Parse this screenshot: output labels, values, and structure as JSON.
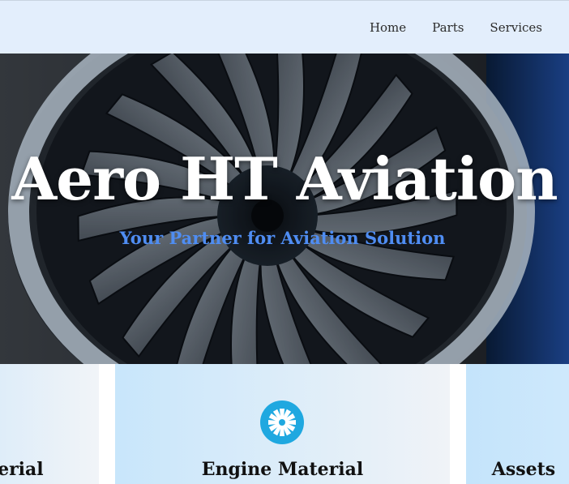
{
  "nav": {
    "items": [
      {
        "label": "Home"
      },
      {
        "label": "Parts"
      },
      {
        "label": "Services"
      }
    ]
  },
  "hero": {
    "title": "Aero HT Aviation",
    "subtitle": "Your Partner for Aviation Solution",
    "background": "jet-engine-fan-photo"
  },
  "cards": [
    {
      "title": "Material",
      "icon": null
    },
    {
      "title": "Engine Material",
      "icon": "fan-icon",
      "icon_color": "#1fa8e0"
    },
    {
      "title": "Assets",
      "icon": null
    }
  ],
  "colors": {
    "nav_bg": "#e3eefc",
    "subtitle": "#4f8df2",
    "card_icon": "#1fa8e0"
  }
}
